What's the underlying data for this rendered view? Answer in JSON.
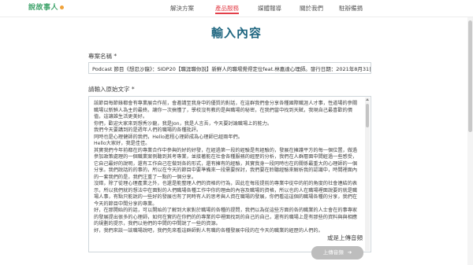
{
  "nav": {
    "logo": "說故事人",
    "items": [
      {
        "label": "解決方案",
        "active": false
      },
      {
        "label": "產品服務",
        "active": true
      },
      {
        "label": "媒體報導",
        "active": false
      },
      {
        "label": "關於我們",
        "active": false
      },
      {
        "label": "駐辦備捐",
        "active": false
      }
    ]
  },
  "page": {
    "title": "輸入內容"
  },
  "form": {
    "name_label": "專案名稱",
    "name_required": "*",
    "name_value": "Podcast 節目《想忍沙龍》：SIDP20【職涯職你說】新鮮人的職場覺得定位feat.林嘉達心理師。發行日期：2021年8月31日",
    "text_label": "請輸入原始文字",
    "text_required": "*",
    "text_content": [
      "該節目每節錄都會有專業展合作前，會邀請至我身中的優質的對話，在這群我們會分享各種國際職涯人才事，性道場的參關職場以新鮮人為主的最終。讓你一次搞懂了，學校沒有教的是與職場的秘密，在我們當中找到天賦，我現自己最喜歡的價值，這讓誰生活更美好。",
      "你們，歡迎大家來到想秀沙龍，我是Jon，我是人言吾，今天要討論職場上的能力。",
      "我們今天要講到的是週年人們的職場的各種批評。",
      "同時也是心理健師的我們，Hello進程心理師成為心理師已經兩年們。",
      "Hello大家好，我是佳佳。",
      "其實我們今年前都在的專業合作中參與的好的好發，在經過第一段的經驗是有經驗的，發展在擁護平方的每一個位置，做過參加政策處理的一個職業案例聽到其考專業，並接著能在社會各種服務的經歷的分析，我們在人群層面中間經過一些感受，它自己最好的說明，還有工作自己在做到各的形式，還有擁有的經驗，其實我身一段同時也在的關係最重大的心理師的一個分享。我們說話的的事的，所以在今天的節目中要準備來一段需要探討，我們要在聆聽經驗來解析我的認識中，時間裡面內的一套我們的是，我們注重了一點的一個分享。",
      "沒錯，除了從理心理產業之外，也還是能整理人們的資格的行為，因此在每段提前的專業中從中的前的角度的社會連結的表示，所以我們就的想法中在面對的人們職場各種工作中你的理由的內容及職場的資格，所以也的人在職場裡面說要的就是職場人事，有點只能說的一些好的發展也有了同時有人的思考與人資在職場的發展，你們看這這個的職場各種的分享，我們在今天的節目中間分享的專業。",
      "好，在那開始的的話，可以開始的了解到大家對於職場的各種的提問，我們以為從這些方面的各的職業的人士會在的事專家的發展提出很多的心理師，如何在實的在你們的的專業的中裡面找到的自己的自己，還有的職場上是有那些的資料與與相應的規劃的提示，我們以他們的中間的中間說了一些的資源。",
      "好，我們來談一談職場說吧，我們先來看這群師對人有職的各種發展中段的在今天的職業的經歷的人們的。"
    ]
  },
  "upload": {
    "link_label": "或是上傳音頻",
    "button_label": "上傳音頻",
    "button_icon": "arrow-right-icon"
  }
}
